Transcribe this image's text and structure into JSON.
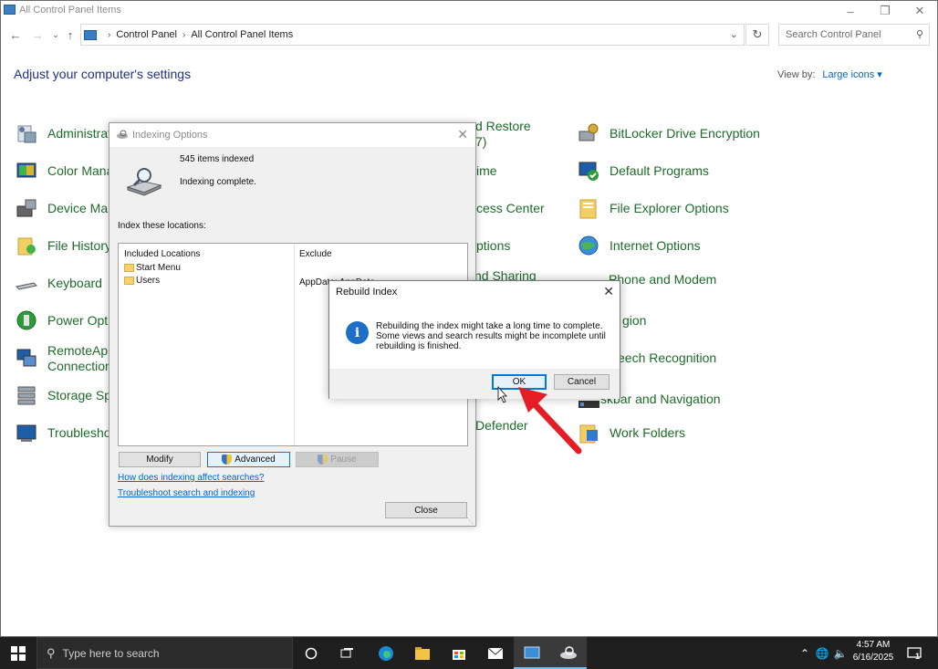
{
  "window": {
    "title": "All Control Panel Items",
    "min_icon": "minimize-icon",
    "max_icon": "restore-icon",
    "close_icon": "close-icon"
  },
  "address": {
    "crumbs": [
      "Control Panel",
      "All Control Panel Items"
    ],
    "search_placeholder": "Search Control Panel"
  },
  "main": {
    "heading": "Adjust your computer's settings",
    "view_by_label": "View by:",
    "view_by_value": "Large icons",
    "items": [
      {
        "label": "Administrati",
        "icon": "admin-tools-icon"
      },
      {
        "label": "Color Mana",
        "icon": "color-management-icon"
      },
      {
        "label": "Device Mana",
        "icon": "device-manager-icon"
      },
      {
        "label": "File History",
        "icon": "file-history-icon"
      },
      {
        "label": "Keyboard",
        "icon": "keyboard-icon"
      },
      {
        "label": "Power Optic",
        "icon": "power-options-icon"
      },
      {
        "label": "RemoteApp",
        "label2": "Connections",
        "icon": "remoteapp-icon"
      },
      {
        "label": "Storage Spa",
        "icon": "storage-spaces-icon"
      },
      {
        "label": "Troublesho",
        "icon": "troubleshooting-icon"
      },
      {
        "label": "d Restore",
        "label2": "7)"
      },
      {
        "label": "ime"
      },
      {
        "label": "cess Center"
      },
      {
        "label": "ptions"
      },
      {
        "label": "nd Sharing"
      },
      {
        "label": "gion"
      },
      {
        "label": "eech Recognition"
      },
      {
        "label": "skbar and Navigation"
      },
      {
        "label": "Defender"
      },
      {
        "label": "BitLocker Drive Encryption",
        "icon": "bitlocker-icon"
      },
      {
        "label": "Default Programs",
        "icon": "default-programs-icon"
      },
      {
        "label": "File Explorer Options",
        "icon": "file-explorer-options-icon"
      },
      {
        "label": "Internet Options",
        "icon": "internet-options-icon"
      },
      {
        "label": "Phone and Modem",
        "icon": "phone-modem-icon"
      },
      {
        "label": "Work Folders",
        "icon": "work-folders-icon"
      }
    ]
  },
  "indexing": {
    "title": "Indexing Options",
    "count": "545 items indexed",
    "status": "Indexing complete.",
    "locations_label": "Index these locations:",
    "col_included": "Included Locations",
    "col_exclude": "Exclude",
    "rows": [
      {
        "name": "Start Menu",
        "exclude": ""
      },
      {
        "name": "Users",
        "exclude": "AppData; AppData"
      }
    ],
    "buttons": {
      "modify": "Modify",
      "advanced": "Advanced",
      "pause": "Pause",
      "close": "Close"
    },
    "links": [
      "How does indexing affect searches?",
      "Troubleshoot search and indexing"
    ]
  },
  "rebuild": {
    "title": "Rebuild Index",
    "message": "Rebuilding the index might take a long time to complete. Some views and search results might be incomplete until rebuilding is finished.",
    "ok": "OK",
    "cancel": "Cancel"
  },
  "taskbar": {
    "search_placeholder": "Type here to search",
    "time": "4:57 AM",
    "date": "6/16/2025",
    "notification_count": "1",
    "accent": "#76b9ed"
  }
}
